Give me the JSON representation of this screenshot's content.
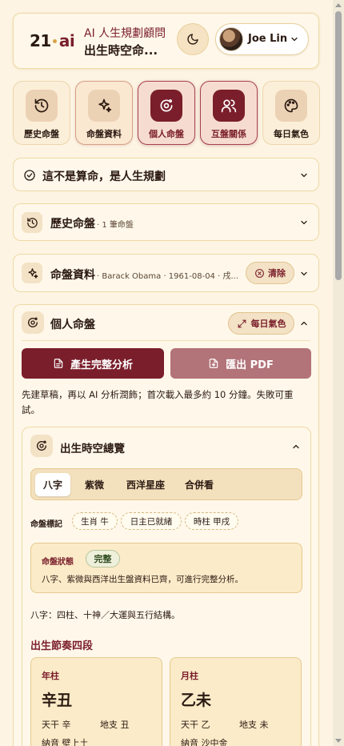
{
  "header": {
    "logo_main": "21",
    "logo_ai": "ai",
    "brand_line1": "AI 人生規劃顧問",
    "brand_line2": "出生時空命...",
    "user_name": "Joe Lin"
  },
  "nav": {
    "tiles": [
      {
        "label": "歷史命盤",
        "icon": "history-icon"
      },
      {
        "label": "命盤資料",
        "icon": "sparkles-icon"
      },
      {
        "label": "個人命盤",
        "icon": "astro-chart-icon"
      },
      {
        "label": "互盤關係",
        "icon": "users-icon"
      },
      {
        "label": "每日氣色",
        "icon": "palette-icon"
      }
    ]
  },
  "sections": {
    "disclaimer": {
      "title": "這不是算命，是人生規劃"
    },
    "history": {
      "title": "歷史命盤",
      "sub": "· 1 筆命盤"
    },
    "chart_data_row": {
      "title": "命盤資料",
      "sub": "· Barack Obama · 1961-08-04 · 戌...",
      "clear_label": "清除"
    }
  },
  "personal": {
    "title": "個人命盤",
    "daily_label": "每日氣色",
    "generate_label": "產生完整分析",
    "pdf_label": "匯出 PDF",
    "note": "先建草稿，再以 AI 分析潤飾；首次載入最多約 10 分鐘。失敗可重試。"
  },
  "overview": {
    "title": "出生時空總覽",
    "tabs": [
      "八字",
      "紫微",
      "西洋星座",
      "合併看"
    ],
    "active_tab": "八字",
    "tags_label": "命盤標記",
    "tags": [
      "生肖 牛",
      "日主已就緒",
      "時柱 甲戌"
    ],
    "status_label": "命盤狀態",
    "status_badge": "完整",
    "status_desc": "八字、紫微與西洋出生盤資料已齊，可進行完整分析。",
    "bazi_desc": "八字：四柱、十神／大運與五行結構。",
    "section_title": "出生節奏四段",
    "pillars": [
      {
        "label": "年柱",
        "main": "辛丑",
        "stem": "天干 辛",
        "branch": "地支 丑",
        "nayin": "納音 壁上土"
      },
      {
        "label": "月柱",
        "main": "乙未",
        "stem": "天干 乙",
        "branch": "地支 未",
        "nayin": "納音 沙中金"
      }
    ]
  },
  "colors": {
    "accent": "#7a1e2b",
    "background": "#fdf4e3",
    "card_border": "#eed9a4",
    "gold": "#d8a24a"
  }
}
